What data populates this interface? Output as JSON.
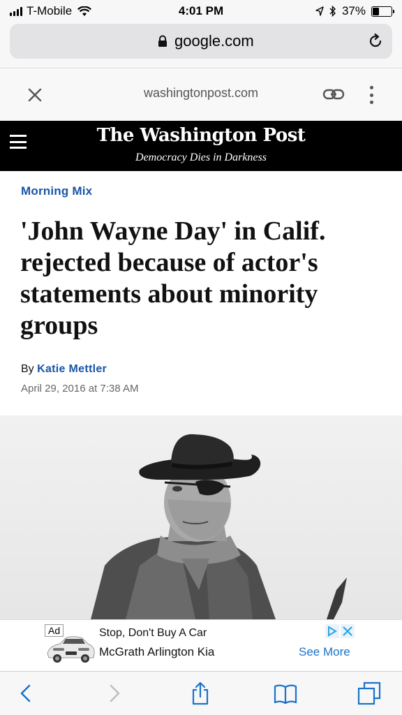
{
  "status_bar": {
    "carrier": "T-Mobile",
    "time": "4:01 PM",
    "battery": "37%",
    "battery_level": 0.37
  },
  "browser": {
    "url": "google.com"
  },
  "amp_header": {
    "domain": "washingtonpost.com"
  },
  "masthead": {
    "logo": "The Washington Post",
    "tagline": "Democracy Dies in Darkness"
  },
  "article": {
    "kicker": "Morning Mix",
    "headline": "'John Wayne Day' in Calif. rejected because of actor's statements about minority groups",
    "byline_prefix": "By",
    "author": "Katie Mettler",
    "date": "April 29, 2016 at 7:38 AM"
  },
  "ad": {
    "label": "Ad",
    "line1": "Stop, Don't Buy A Car",
    "line2": "McGrath Arlington Kia",
    "cta": "See More"
  },
  "icons": {
    "status": [
      "signal-icon",
      "wifi-icon",
      "location-icon",
      "bluetooth-icon",
      "battery-icon"
    ],
    "browser": [
      "lock-icon",
      "reload-icon"
    ],
    "amp": [
      "close-icon",
      "link-icon",
      "more-icon"
    ],
    "toolbar": [
      "back-icon",
      "forward-icon",
      "share-icon",
      "bookmarks-icon",
      "tabs-icon"
    ]
  },
  "colors": {
    "accent_blue": "#1955a5",
    "ad_cta_blue": "#1a72c9",
    "toolbar_blue": "#1a72c9",
    "masthead_bg": "#000000"
  }
}
